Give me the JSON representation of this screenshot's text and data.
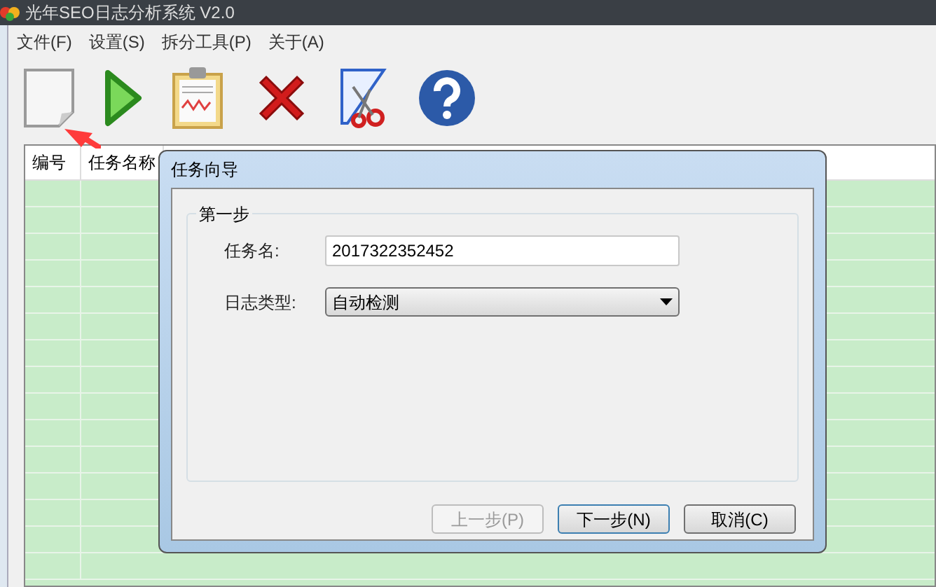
{
  "window": {
    "title": "光年SEO日志分析系统 V2.0"
  },
  "menu": [
    "文件(F)",
    "设置(S)",
    "拆分工具(P)",
    "关于(A)"
  ],
  "table": {
    "columns": [
      "编号",
      "任务名称"
    ]
  },
  "dialog": {
    "title": "任务向导",
    "group": "第一步",
    "fields": [
      {
        "kind": "text",
        "label": "任务名:",
        "value": "2017322352452"
      },
      {
        "kind": "select",
        "label": "日志类型:",
        "value": "自动检测"
      }
    ],
    "buttons": [
      {
        "label": "上一步(P)",
        "disabled": true,
        "default": false
      },
      {
        "label": "下一步(N)",
        "disabled": false,
        "default": true
      },
      {
        "label": "取消(C)",
        "disabled": false,
        "default": false
      }
    ]
  }
}
